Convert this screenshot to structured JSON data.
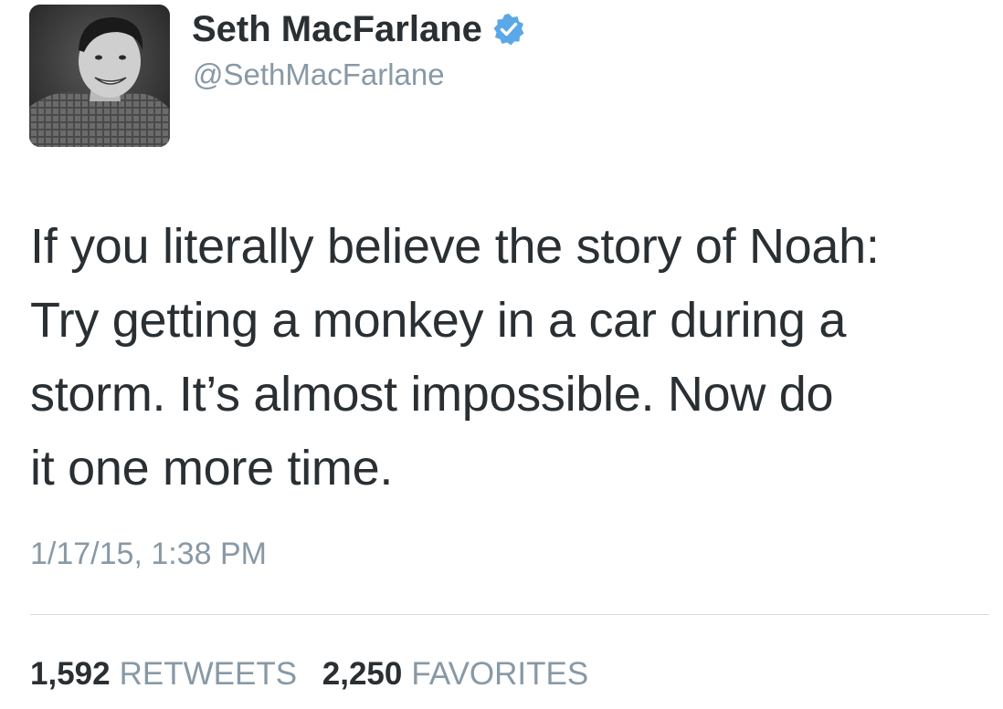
{
  "profile": {
    "display_name": "Seth MacFarlane",
    "handle": "@SethMacFarlane",
    "avatar_icon": "profile-photo",
    "verified_icon": "verified-badge-icon",
    "verified_color": "#5aa8e8"
  },
  "tweet": {
    "lines": [
      "If you literally believe the story of Noah:",
      "Try getting a monkey in a car during a",
      "storm. It’s almost impossible. Now do",
      "it one more time."
    ],
    "timestamp": "1/17/15, 1:38 PM"
  },
  "stats": {
    "retweets_count": "1,592",
    "retweets_label": "RETWEETS",
    "favorites_count": "2,250",
    "favorites_label": "FAVORITES"
  },
  "colors": {
    "text": "#292f33",
    "secondary": "#8899a6",
    "divider": "#d8dde1"
  }
}
